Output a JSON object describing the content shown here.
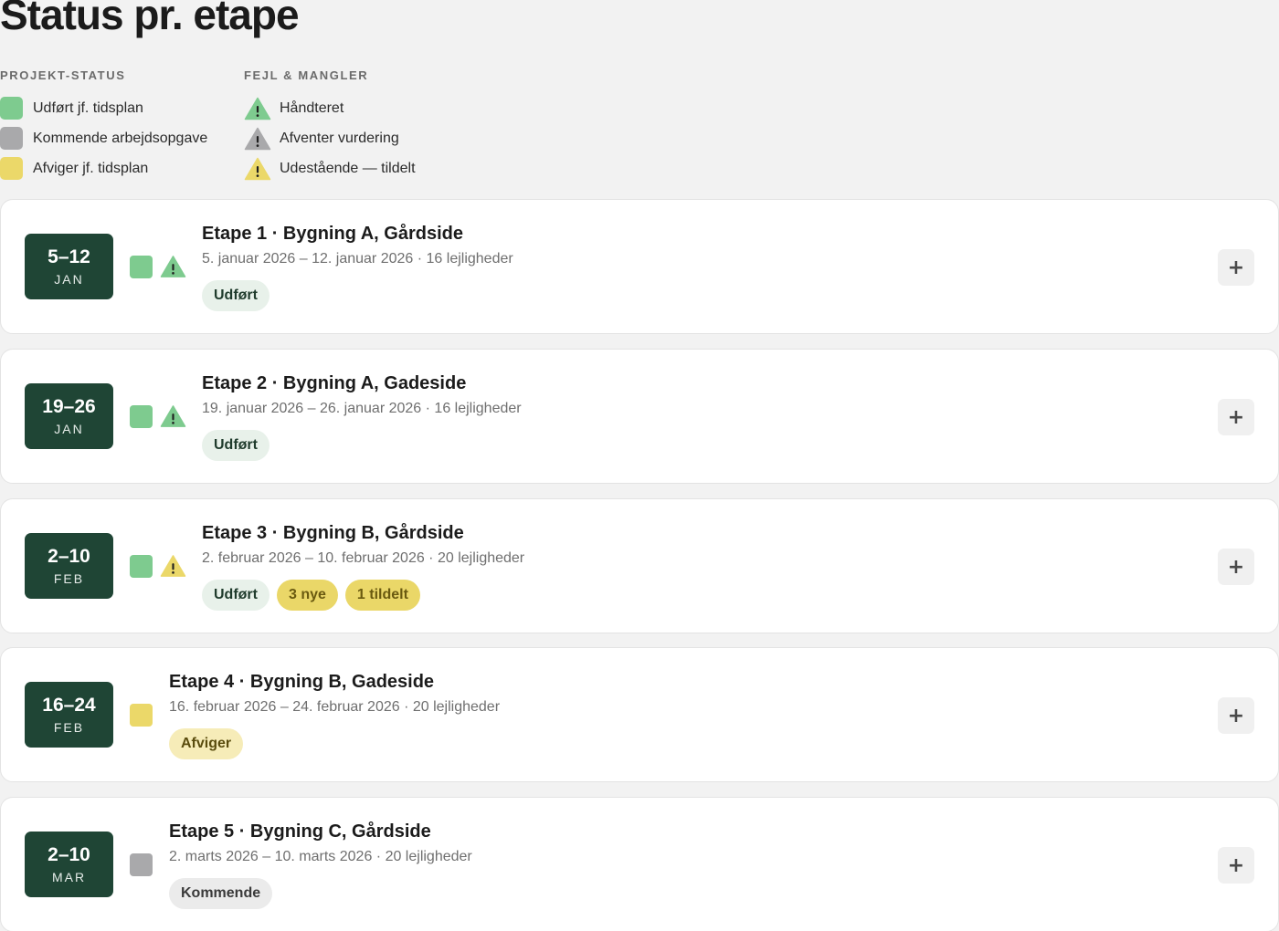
{
  "page": {
    "title": "Status pr. etape"
  },
  "colors": {
    "green": "#7ecb8f",
    "grey": "#a9a9ab",
    "yellow": "#ebd869",
    "badge": "#1f4535"
  },
  "legend": {
    "project_status": {
      "heading": "PROJEKT-STATUS",
      "items": [
        {
          "label": "Udført jf. tidsplan",
          "color": "green"
        },
        {
          "label": "Kommende arbejdsopgave",
          "color": "grey"
        },
        {
          "label": "Afviger jf. tidsplan",
          "color": "yellow"
        }
      ]
    },
    "defects": {
      "heading": "FEJL & MANGLER",
      "items": [
        {
          "label": "Håndteret",
          "color": "green",
          "icon": "warning-triangle-icon"
        },
        {
          "label": "Afventer vurdering",
          "color": "grey",
          "icon": "warning-triangle-icon"
        },
        {
          "label": "Udestående — tildelt",
          "color": "yellow",
          "icon": "warning-triangle-icon"
        }
      ]
    }
  },
  "stages": [
    {
      "date_range": "5–12",
      "month": "JAN",
      "status_color": "green",
      "defect_color": "green",
      "title": "Etape 1 · Bygning A, Gårdside",
      "subtitle": "5. januar 2026 – 12. januar 2026 · 16 lejligheder",
      "chips": [
        {
          "label": "Udført",
          "kind": "done"
        }
      ],
      "action_label": "+"
    },
    {
      "date_range": "19–26",
      "month": "JAN",
      "status_color": "green",
      "defect_color": "green",
      "title": "Etape 2 · Bygning A, Gadeside",
      "subtitle": "19. januar 2026 – 26. januar 2026 · 16 lejligheder",
      "chips": [
        {
          "label": "Udført",
          "kind": "done"
        }
      ],
      "action_label": "+"
    },
    {
      "date_range": "2–10",
      "month": "FEB",
      "status_color": "green",
      "defect_color": "yellow",
      "title": "Etape 3 · Bygning B, Gårdside",
      "subtitle": "2. februar 2026 – 10. februar 2026 · 20 lejligheder",
      "chips": [
        {
          "label": "Udført",
          "kind": "done"
        },
        {
          "label": "3 nye",
          "kind": "yellow"
        },
        {
          "label": "1 tildelt",
          "kind": "yellow"
        }
      ],
      "action_label": "+"
    },
    {
      "date_range": "16–24",
      "month": "FEB",
      "status_color": "yellow",
      "defect_color": null,
      "title": "Etape 4 · Bygning B, Gadeside",
      "subtitle": "16. februar 2026 – 24. februar 2026 · 20 lejligheder",
      "chips": [
        {
          "label": "Afviger",
          "kind": "deviate"
        }
      ],
      "action_label": "+"
    },
    {
      "date_range": "2–10",
      "month": "MAR",
      "status_color": "grey",
      "defect_color": null,
      "title": "Etape 5 · Bygning C, Gårdside",
      "subtitle": "2. marts 2026 – 10. marts 2026 · 20 lejligheder",
      "chips": [
        {
          "label": "Kommende",
          "kind": "upcoming"
        }
      ],
      "action_label": "+"
    }
  ]
}
